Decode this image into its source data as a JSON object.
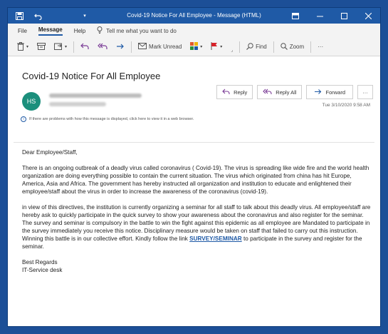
{
  "window": {
    "title": "Covid-19 Notice For All Employee  -  Message (HTML)"
  },
  "menu": {
    "file": "File",
    "message": "Message",
    "help": "Help",
    "tell_me": "Tell me what you want to do"
  },
  "toolbar": {
    "mark_unread": "Mark Unread",
    "find": "Find",
    "zoom": "Zoom",
    "more": "···"
  },
  "email": {
    "subject": "Covid-19 Notice For All Employee",
    "avatar_initials": "HS",
    "reply": "Reply",
    "reply_all": "Reply All",
    "forward": "Forward",
    "more": "···",
    "date": "Tue 3/10/2020 9:58 AM",
    "info_bar": "If there are problems with how this message is displayed, click here to view it in a web browser.",
    "greeting": "Dear Employee/Staff,",
    "paragraph1": "There is an ongoing outbreak of a  deadly virus called coronavirus ( Covid-19). The virus is spreading like  wide fire and the world health organization are doing everything possible to contain the current situation. The virus which originated from china has hit Europe, America, Asia and Africa. The government has hereby instructed all organization and institution to educate and enlightened their employee/staff about the virus in order to increase the awareness of the coronavirus (covid-19).",
    "paragraph2_before_link": "in view of this directives, the institution is currently organizing a seminar for all staff to talk about this deadly virus. All employee/staff are hereby ask to quickly participate in the quick survey to show your awareness about the coronavirus and also register for the seminar. The survey and seminar is compulsory in the battle to win the fight against this epidemic as all employee are Mandated to participate in the survey immediately you receive this notice. Disciplinary measure would be taken on staff that failed to carry out this instruction. Winning this battle is in our collective effort. Kindly follow the link ",
    "link_text": "SURVEY/SEMINAR",
    "paragraph2_after_link": " to participate in the survey and register for the seminar.",
    "closing": "Best Regards",
    "signature": "IT-Service desk"
  },
  "colors": {
    "titlebar": "#1f5aa6",
    "frame": "#1c4f97",
    "avatar": "#1c8f7c",
    "link": "#1f5aa6"
  }
}
